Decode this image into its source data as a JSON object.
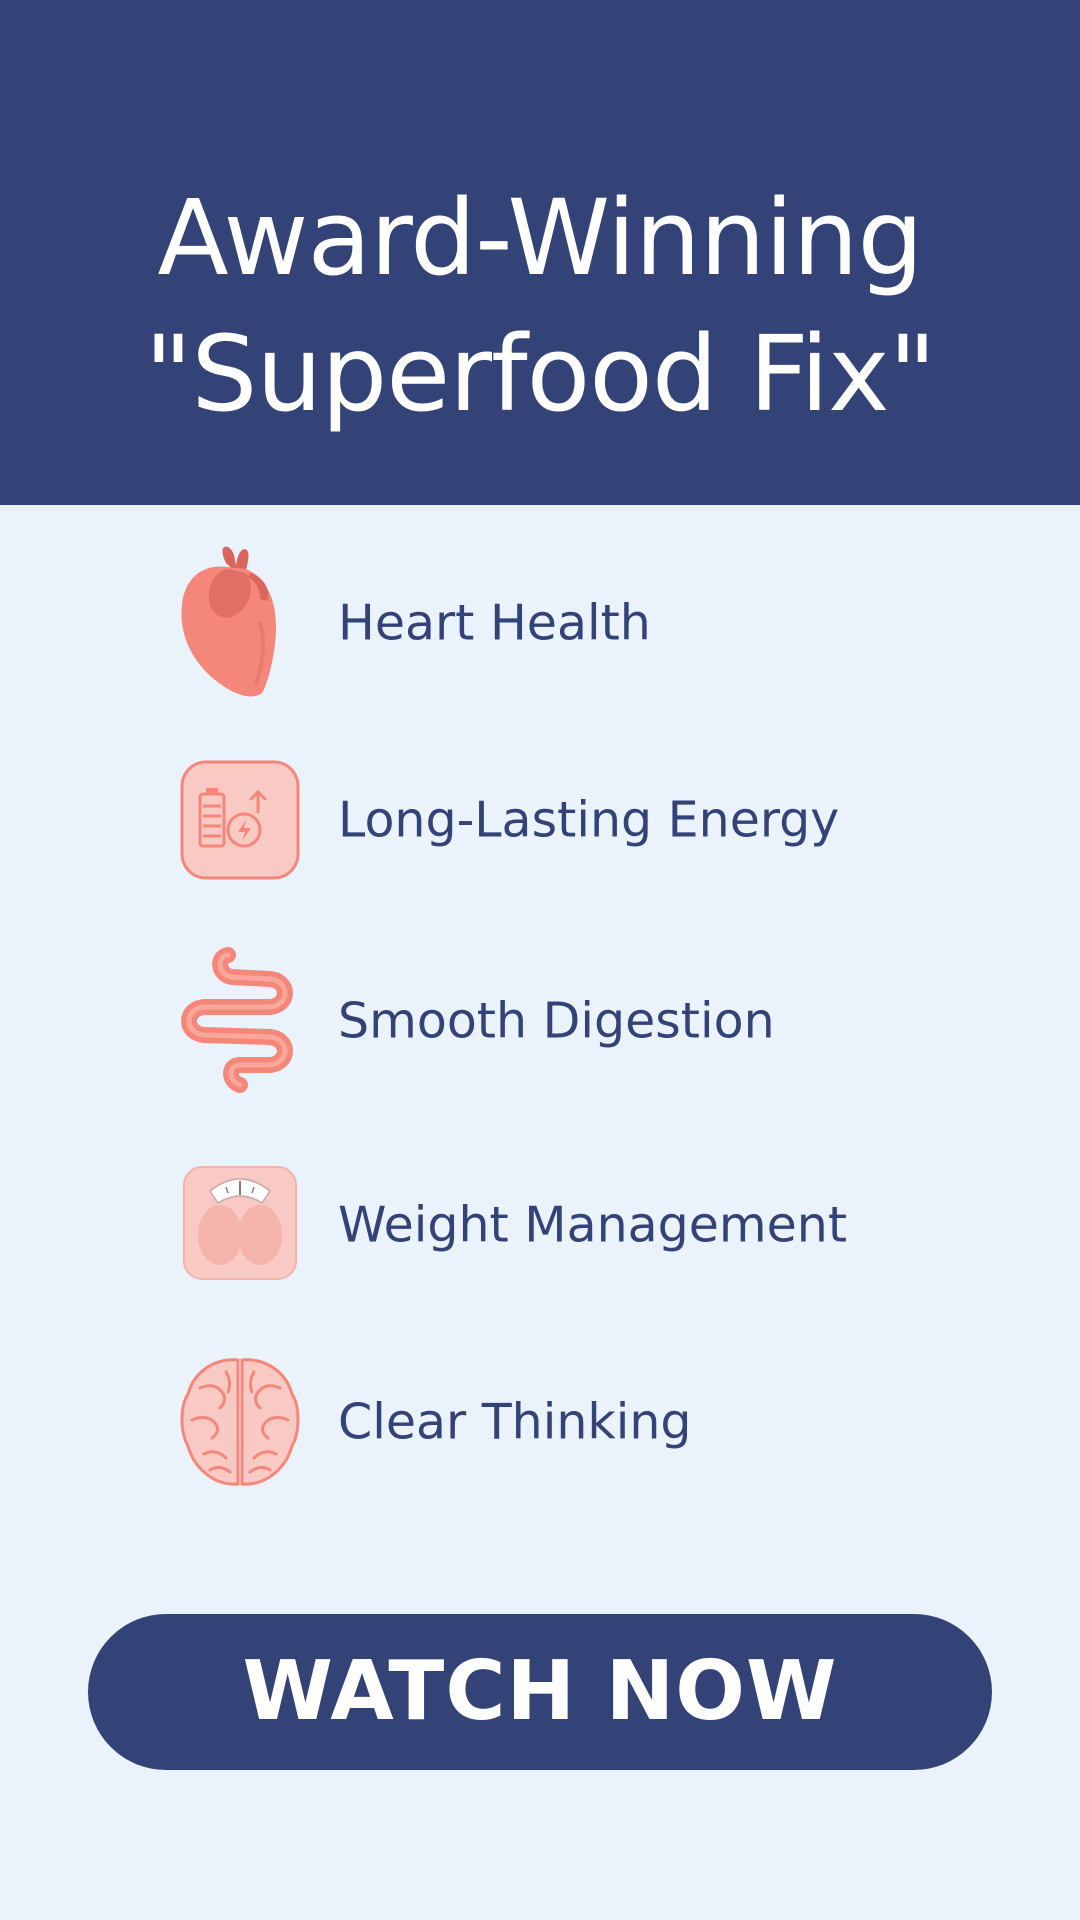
{
  "header": {
    "title_line1": "Award-Winning",
    "title_line2": "\"Superfood Fix\""
  },
  "benefits": [
    {
      "label": "Heart Health",
      "icon": "heart-organ-icon"
    },
    {
      "label": "Long-Lasting Energy",
      "icon": "battery-energy-icon"
    },
    {
      "label": "Smooth Digestion",
      "icon": "intestine-icon"
    },
    {
      "label": "Weight Management",
      "icon": "weight-scale-icon"
    },
    {
      "label": "Clear Thinking",
      "icon": "brain-icon"
    }
  ],
  "cta": {
    "label": "WATCH NOW"
  },
  "colors": {
    "navy": "#334378",
    "background": "#eaf2fc",
    "icon_coral": "#f4877a",
    "icon_pink": "#f9c9c3"
  }
}
